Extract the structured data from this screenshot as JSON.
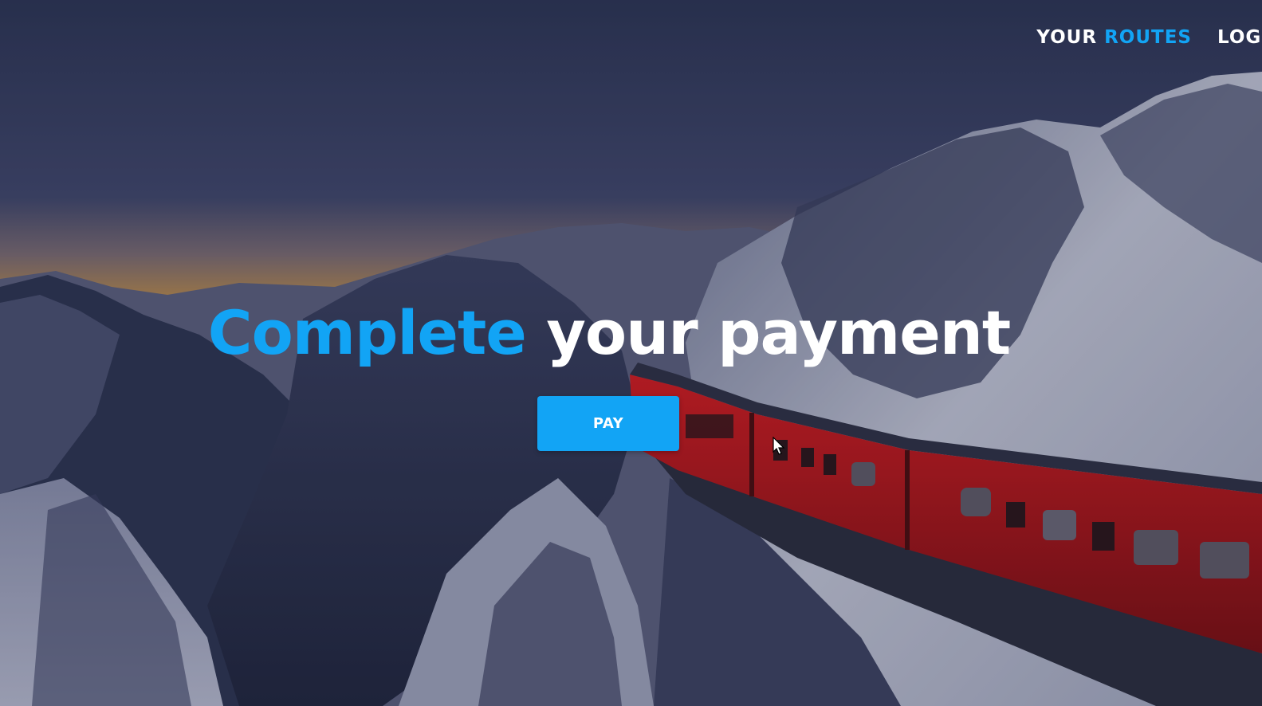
{
  "nav": {
    "routes_part1": "YOUR",
    "routes_part2": "ROUTES",
    "login": "LOG"
  },
  "hero": {
    "headline_accent": "Complete",
    "headline_rest": "your payment",
    "pay_label": "PAY"
  },
  "colors": {
    "accent": "#12a4f5",
    "train": "#c8161b",
    "sky": "#2f3757"
  },
  "icons": {
    "cursor": "mouse-pointer-icon"
  }
}
